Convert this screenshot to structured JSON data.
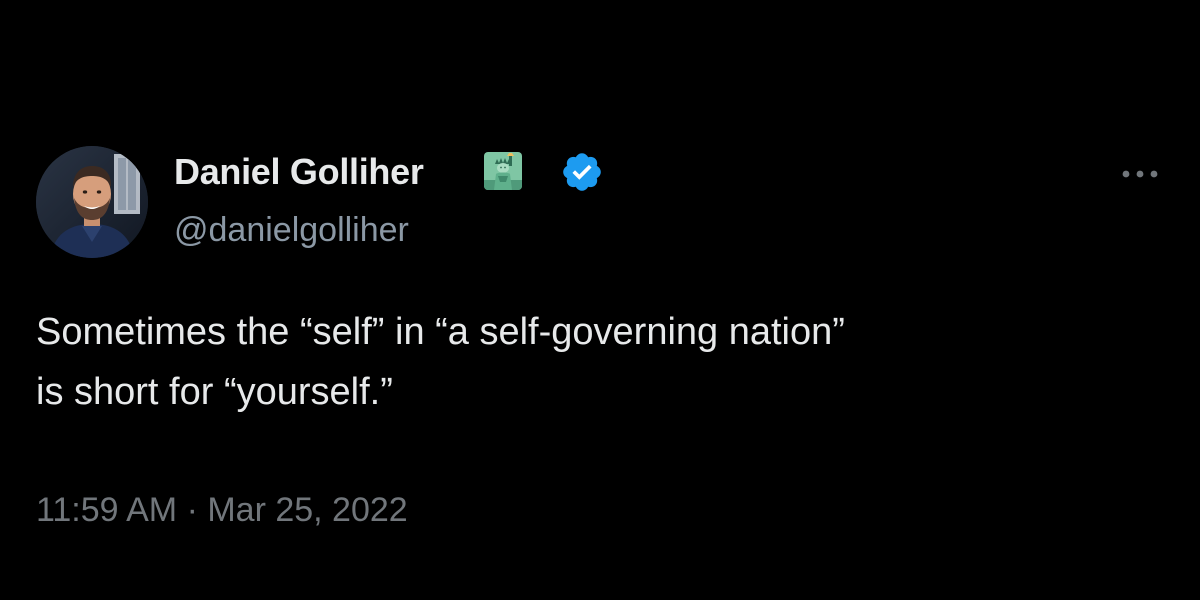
{
  "tweet": {
    "author": {
      "name": "Daniel Golliher",
      "handle": "@danielgolliher",
      "name_emoji": "statue-of-liberty-icon",
      "verified_badge": "verified-badge-icon",
      "verified_color": "#1d9bf0"
    },
    "text_lines": [
      "Sometimes the “self” in “a self-governing nation”",
      "is short for “yourself.”"
    ],
    "timestamp": "11:59 AM · Mar 25, 2022",
    "more_menu_icon": "more-horizontal-icon"
  },
  "colors": {
    "background": "#000000",
    "primary_text": "#e7e9ea",
    "secondary_text": "#8b98a5",
    "timestamp_text": "#71767b"
  }
}
